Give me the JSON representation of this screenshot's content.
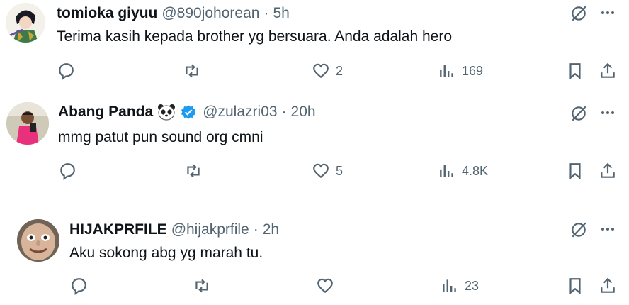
{
  "tweets": [
    {
      "display_name": "tomioka giyuu",
      "handle": "@890johorean",
      "dot": "·",
      "time": "5h",
      "text": "Terima kasih kepada brother yg bersuara. Anda adalah hero",
      "likes": "2",
      "views": "169",
      "verified": false
    },
    {
      "display_name": "Abang Panda",
      "handle": "@zulazri03",
      "dot": "·",
      "time": "20h",
      "text": "mmg patut pun sound org cmni",
      "likes": "5",
      "views": "4.8K",
      "verified": true,
      "name_emoji": "panda-face"
    },
    {
      "display_name": "HIJAKPRFILE",
      "handle": "@hijakprfile",
      "dot": "·",
      "time": "2h",
      "text": "Aku sokong abg yg marah tu.",
      "likes": "",
      "views": "23",
      "verified": false
    }
  ],
  "colors": {
    "text": "#0f1419",
    "muted": "#536471",
    "verified": "#1d9bf0",
    "divider": "#eff3f4"
  },
  "icons": [
    "reply-icon",
    "repost-icon",
    "like-icon",
    "views-icon",
    "bookmark-icon",
    "share-icon",
    "grok-icon",
    "more-icon"
  ]
}
